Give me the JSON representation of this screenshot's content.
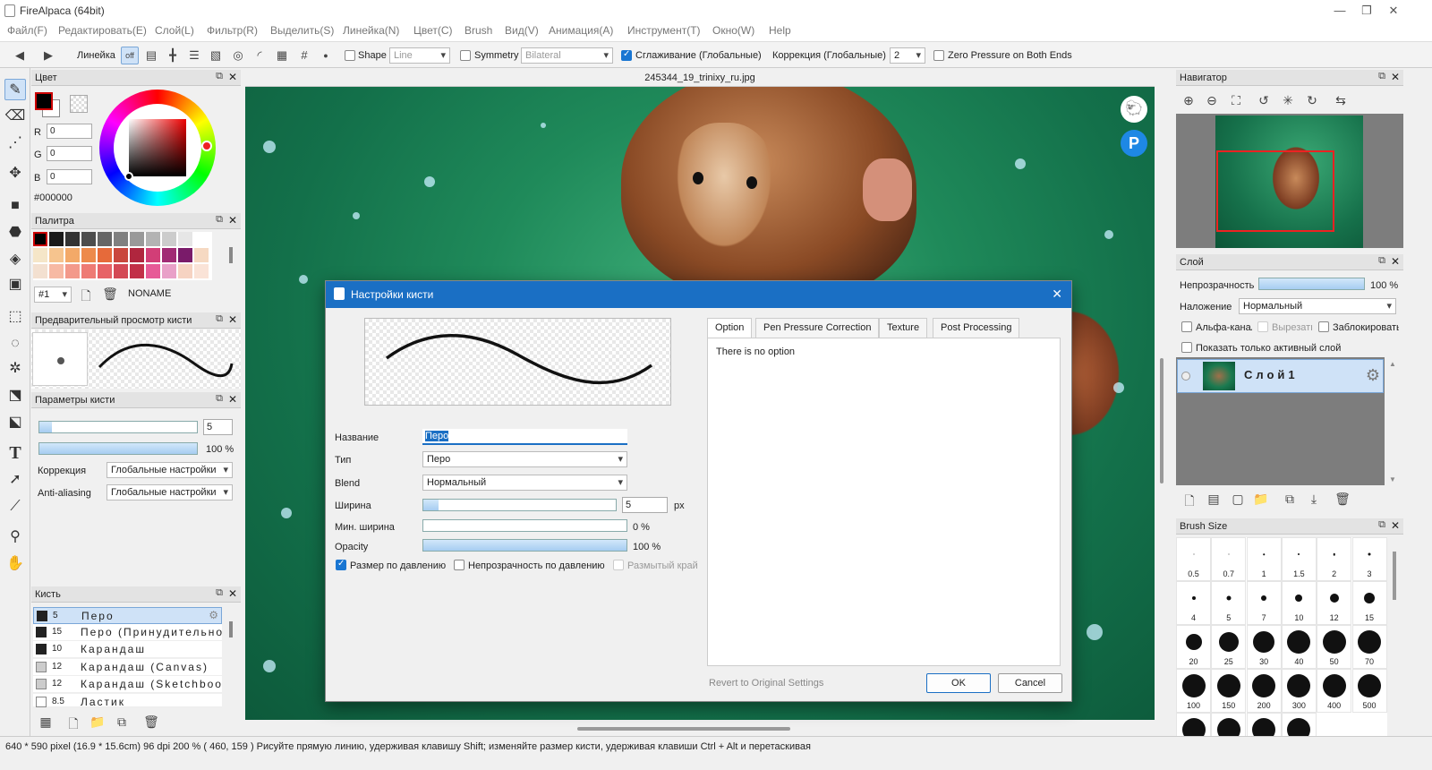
{
  "window": {
    "title": "FireAlpaca (64bit)"
  },
  "menu": [
    "Файл(F)",
    "Редактировать(E)",
    "Слой(L)",
    "Фильтр(R)",
    "Выделить(S)",
    "Линейка(N)",
    "Цвет(C)",
    "Brush",
    "Вид(V)",
    "Анимация(A)",
    "Инструмент(T)",
    "Окно(W)",
    "Help"
  ],
  "toolbar": {
    "ruler_label": "Линейка",
    "snap_off": "off",
    "shape_label": "Shape",
    "shape_value": "Line",
    "symmetry_label": "Symmetry",
    "symmetry_value": "Bilateral",
    "smoothing_label": "Сглаживание (Глобальные)",
    "correction_label": "Коррекция (Глобальные)",
    "correction_value": "2",
    "zero_pressure_label": "Zero Pressure on Both Ends"
  },
  "color_panel": {
    "title": "Цвет",
    "r_label": "R",
    "g_label": "G",
    "b_label": "B",
    "r": "0",
    "g": "0",
    "b": "0",
    "hex": "#000000",
    "primary": "#000000"
  },
  "palette_panel": {
    "title": "Палитра",
    "index": "#1",
    "name": "NONAME",
    "swatches": [
      "#000000",
      "#1a1a1a",
      "#333333",
      "#4d4d4d",
      "#666666",
      "#808080",
      "#999999",
      "#b3b3b3",
      "#cccccc",
      "#e6e6e6",
      "#ffffff",
      "#f5e6c8",
      "#f6c48e",
      "#f3a968",
      "#ed8a4c",
      "#e66a3a",
      "#c9473d",
      "#b0263e",
      "#d23e77",
      "#a12a74",
      "#7a1b6a",
      "#f6d9c2",
      "#f3e0d0",
      "#f7b9a3",
      "#f3998a",
      "#ee7b74",
      "#e76266",
      "#d44955",
      "#c23048",
      "#e75a97",
      "#e9a0c8",
      "#f6d3c2",
      "#fae3d7"
    ]
  },
  "brush_preview_panel": {
    "title": "Предварительный просмотр кисти"
  },
  "brush_params_panel": {
    "title": "Параметры кисти",
    "width_value": "5",
    "opacity_value": "100 %",
    "correction_label": "Коррекция",
    "correction_value": "Глобальные настройки",
    "aa_label": "Anti-aliasing",
    "aa_value": "Глобальные настройки",
    "width_fraction": 0.08,
    "opacity_fraction": 1.0
  },
  "brush_panel": {
    "title": "Кисть",
    "items": [
      {
        "size": "5",
        "name": "Перо"
      },
      {
        "size": "15",
        "name": "Перо (Принудительно)"
      },
      {
        "size": "10",
        "name": "Карандаш"
      },
      {
        "size": "12",
        "name": "Карандаш (Canvas)"
      },
      {
        "size": "12",
        "name": "Карандаш (Sketchbook)"
      },
      {
        "size": "8.5",
        "name": "Ластик"
      }
    ]
  },
  "canvas": {
    "filename": "245344_19_trinixy_ru.jpg"
  },
  "dialog": {
    "title": "Настройки кисти",
    "name_label": "Название",
    "name_value": "Перо",
    "type_label": "Тип",
    "type_value": "Перо",
    "blend_label": "Blend",
    "blend_value": "Нормальный",
    "width_label": "Ширина",
    "width_value": "5",
    "width_unit": "px",
    "width_fraction": 0.08,
    "minwidth_label": "Мин. ширина",
    "minwidth_value": "0 %",
    "minwidth_fraction": 0.0,
    "opacity_label": "Opacity",
    "opacity_value": "100 %",
    "opacity_fraction": 1.0,
    "size_pressure_label": "Размер по давлению",
    "opacity_pressure_label": "Непрозрачность по давлению",
    "blur_edge_label": "Размытый край",
    "tabs": [
      "Option",
      "Pen Pressure Correction",
      "Texture",
      "Post Processing"
    ],
    "no_option": "There is no option",
    "revert": "Revert to Original Settings",
    "ok": "OK",
    "cancel": "Cancel"
  },
  "navigator": {
    "title": "Навигатор"
  },
  "layer_panel": {
    "title": "Слой",
    "opacity_label": "Непрозрачность",
    "opacity_value": "100 %",
    "opacity_fraction": 1.0,
    "blend_label": "Наложение",
    "blend_value": "Нормальный",
    "alpha_label": "Альфа-канал",
    "clip_label": "Вырезать",
    "lock_label": "Заблокировать",
    "show_active_label": "Показать только активный слой",
    "layer_name": "Слой1"
  },
  "brush_size_panel": {
    "title": "Brush Size",
    "sizes": [
      "0.5",
      "0.7",
      "1",
      "1.5",
      "2",
      "3",
      "4",
      "5",
      "7",
      "10",
      "12",
      "15",
      "20",
      "25",
      "30",
      "40",
      "50",
      "70",
      "100",
      "150",
      "200",
      "300",
      "400",
      "500"
    ]
  },
  "status": {
    "text": "640 * 590 pixel   (16.9 * 15.6cm)   96 dpi   200 %   ( 460, 159 )   Рисуйте прямую линию, удерживая клавишу Shift; изменяйте размер кисти, удерживая клавиши Ctrl + Alt и перетаскивая"
  }
}
